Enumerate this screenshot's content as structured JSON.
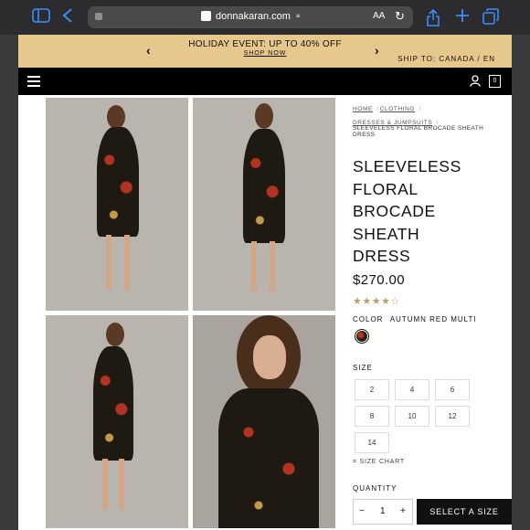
{
  "browser": {
    "url": "donnakaran.com",
    "reader_label": "AA",
    "icons": [
      "sidebar-icon",
      "back-icon",
      "share-icon",
      "new-tab-icon",
      "tabs-icon",
      "lock-icon",
      "reload-icon"
    ]
  },
  "promo": {
    "message": "HOLIDAY EVENT: UP TO 40% OFF",
    "cta": "SHOP NOW",
    "ship_to": "SHIP TO: CANADA / EN",
    "prev": "‹",
    "next": "›"
  },
  "nav": {
    "icons": [
      "menu-icon",
      "account-icon",
      "bag-icon"
    ],
    "bag_count": "0"
  },
  "breadcrumbs": [
    "HOME",
    "CLOTHING",
    "DRESSES & JUMPSUITS",
    "SLEEVELESS FLORAL BROCADE SHEATH DRESS"
  ],
  "product": {
    "title_lines": [
      "SLEEVELESS",
      "FLORAL",
      "BROCADE",
      "SHEATH",
      "DRESS"
    ],
    "price": "$270.00",
    "rating": {
      "stars_filled": 4,
      "stars_total": 5,
      "display": "★★★★☆"
    },
    "color_label": "COLOR",
    "color_value": "AUTUMN RED MULTI",
    "size_label": "SIZE",
    "sizes": [
      "2",
      "4",
      "6",
      "8",
      "10",
      "12",
      "14"
    ],
    "size_chart": "SIZE CHART",
    "quantity_label": "QUANTITY",
    "quantity": "1",
    "minus": "−",
    "plus": "+",
    "select_button": "SELECT A SIZE"
  }
}
